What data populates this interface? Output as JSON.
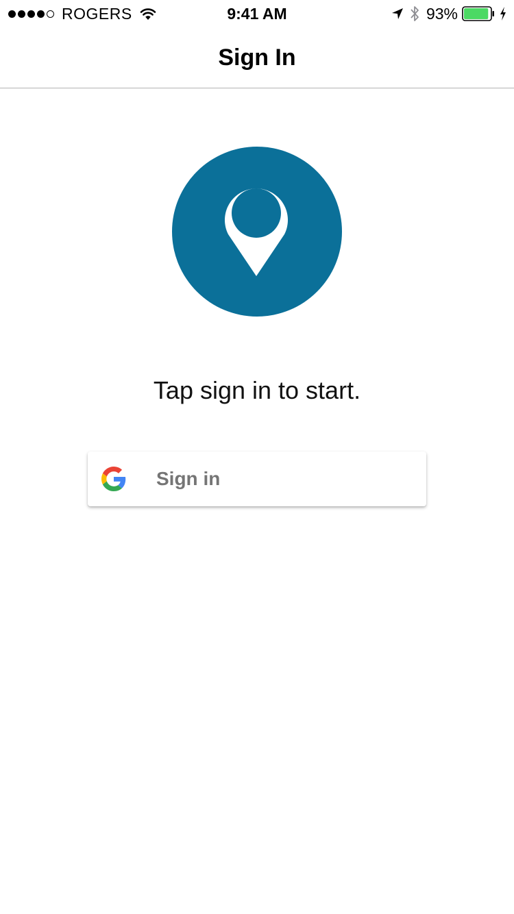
{
  "status_bar": {
    "carrier": "ROGERS",
    "time": "9:41 AM",
    "battery_percent": "93%",
    "signal_bars": 4,
    "signal_total": 5,
    "battery_level": 0.93,
    "icons": [
      "signal-dots-icon",
      "wifi-icon",
      "location-arrow-icon",
      "bluetooth-icon",
      "battery-icon",
      "charging-bolt-icon"
    ]
  },
  "nav": {
    "title": "Sign In"
  },
  "main": {
    "logo_icon": "map-pin-icon",
    "instruction": "Tap sign in to start.",
    "signin_button": {
      "label": "Sign in",
      "icon": "google-g-icon"
    }
  },
  "colors": {
    "logo_background": "#0b7099",
    "battery_fill": "#4cd964",
    "button_text": "#757575",
    "google_blue": "#4285F4",
    "google_red": "#EA4335",
    "google_yellow": "#FBBC05",
    "google_green": "#34A853"
  }
}
